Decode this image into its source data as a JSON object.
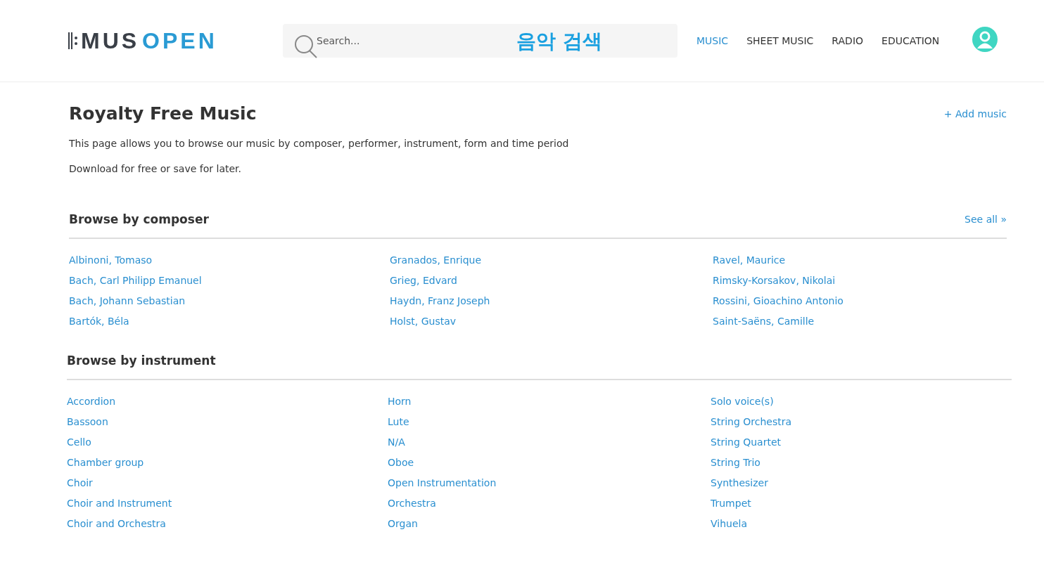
{
  "header": {
    "logo": {
      "dark": "MUS",
      "accent": "OPEN"
    },
    "search": {
      "placeholder": "Search...",
      "annotation": "음악 검색"
    },
    "nav": [
      {
        "label": "MUSIC",
        "selected": true
      },
      {
        "label": "SHEET MUSIC",
        "selected": false
      },
      {
        "label": "RADIO",
        "selected": false
      },
      {
        "label": "EDUCATION",
        "selected": false
      }
    ]
  },
  "page": {
    "title": "Royalty Free Music",
    "action": "+ Add music",
    "paragraphs": [
      "This page allows you to browse our music by composer, performer, instrument, form and time period",
      "Download for free or save for later."
    ]
  },
  "sections": [
    {
      "title": "Browse by composer",
      "link": "See all »",
      "columns": [
        [
          "Albinoni, Tomaso",
          "Bach, Carl Philipp Emanuel",
          "Bach, Johann Sebastian",
          "Bartók, Béla"
        ],
        [
          "Granados, Enrique",
          "Grieg, Edvard",
          "Haydn, Franz Joseph",
          "Holst, Gustav"
        ],
        [
          "Ravel, Maurice",
          "Rimsky-Korsakov, Nikolai",
          "Rossini, Gioachino Antonio",
          "Saint-Saëns, Camille"
        ]
      ]
    },
    {
      "title": "Browse by instrument",
      "columns": [
        [
          "Accordion",
          "Bassoon",
          "Cello",
          "Chamber group",
          "Choir",
          "Choir and Instrument",
          "Choir and Orchestra"
        ],
        [
          "Horn",
          "Lute",
          "N/A",
          "Oboe",
          "Open Instrumentation",
          "Orchestra",
          "Organ"
        ],
        [
          "Solo voice(s)",
          "String Orchestra",
          "String Quartet",
          "String Trio",
          "Synthesizer",
          "Trumpet",
          "Vihuela"
        ]
      ]
    }
  ]
}
